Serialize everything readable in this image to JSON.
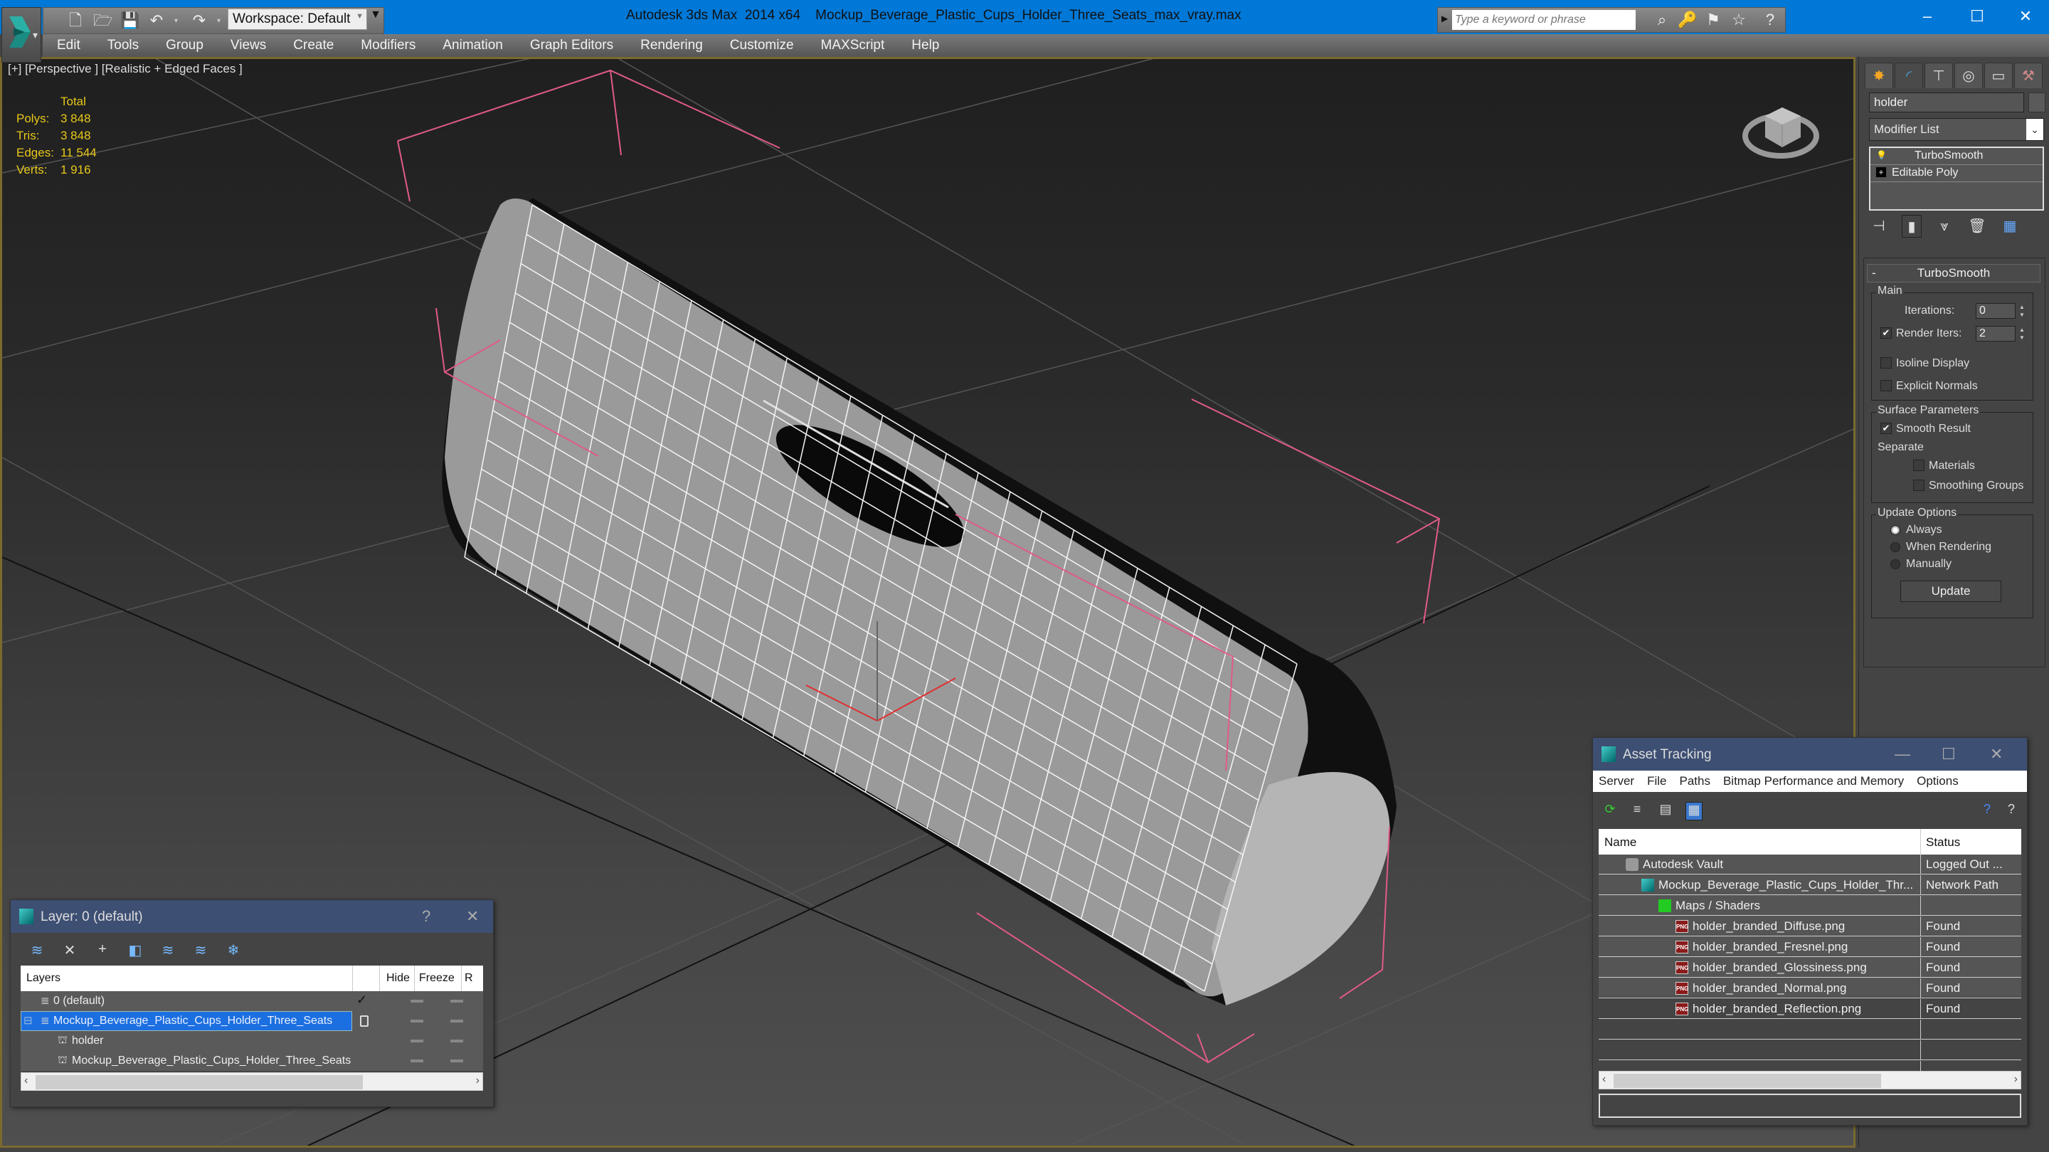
{
  "titlebar": {
    "app_title": "Autodesk 3ds Max  2014 x64",
    "file_name": "Mockup_Beverage_Plastic_Cups_Holder_Three_Seats_max_vray.max",
    "workspace_label": "Workspace: Default",
    "search_placeholder": "Type a keyword or phrase",
    "minimize": "–",
    "maximize": "☐",
    "close": "✕"
  },
  "quick_access": [
    {
      "icon": "new-file-icon",
      "glyph": "🗋"
    },
    {
      "icon": "open-file-icon",
      "glyph": "🗁"
    },
    {
      "icon": "save-icon",
      "glyph": "💾"
    },
    {
      "icon": "undo-icon",
      "glyph": "↶"
    },
    {
      "icon": "redo-icon",
      "glyph": "↷"
    },
    {
      "icon": "project-folder-icon",
      "glyph": "▤"
    }
  ],
  "search_tools": [
    {
      "icon": "binoculars-icon",
      "glyph": "⌕"
    },
    {
      "icon": "key-icon",
      "glyph": "🔑"
    },
    {
      "icon": "communication-center-icon",
      "glyph": "⚑"
    },
    {
      "icon": "favorites-star-icon",
      "glyph": "☆"
    },
    {
      "icon": "help-icon",
      "glyph": "?"
    }
  ],
  "menu": [
    "Edit",
    "Tools",
    "Group",
    "Views",
    "Create",
    "Modifiers",
    "Animation",
    "Graph Editors",
    "Rendering",
    "Customize",
    "MAXScript",
    "Help"
  ],
  "viewport": {
    "label": "[+] [Perspective ] [Realistic + Edged Faces ]",
    "stats": {
      "header": "Total",
      "rows": [
        {
          "label": "Polys:",
          "value": "3 848"
        },
        {
          "label": "Tris:",
          "value": "3 848"
        },
        {
          "label": "Edges:",
          "value": "11 544"
        },
        {
          "label": "Verts:",
          "value": "1 916"
        }
      ]
    },
    "selection_color": "#e05a8a",
    "stats_color": "#e8c81a"
  },
  "command_panel": {
    "tabs": [
      {
        "icon": "create-icon",
        "glyph": "✸"
      },
      {
        "icon": "modify-icon",
        "glyph": "◜"
      },
      {
        "icon": "hierarchy-icon",
        "glyph": "⊤"
      },
      {
        "icon": "motion-icon",
        "glyph": "◎"
      },
      {
        "icon": "display-icon",
        "glyph": "▭"
      },
      {
        "icon": "utilities-icon",
        "glyph": "⚒"
      }
    ],
    "object_name": "holder",
    "modifier_list": "Modifier List",
    "stack": [
      {
        "label": "TurboSmooth",
        "icon": "lightbulb-icon"
      },
      {
        "label": "Editable Poly",
        "icon": "expand-plus-icon"
      }
    ],
    "stack_tools": [
      {
        "icon": "pin-stack-icon",
        "glyph": "⊣"
      },
      {
        "icon": "show-end-result-icon",
        "glyph": "▮"
      },
      {
        "icon": "make-unique-icon",
        "glyph": "⩔"
      },
      {
        "icon": "remove-modifier-icon",
        "glyph": "🗑"
      },
      {
        "icon": "configure-modifier-sets-icon",
        "glyph": "▦"
      }
    ],
    "turbosmooth": {
      "title": "TurboSmooth",
      "collapse": "-",
      "main_title": "Main",
      "iterations_label": "Iterations:",
      "iterations_value": "0",
      "render_iters_label": "Render Iters:",
      "render_iters_value": "2",
      "render_iters_checked": true,
      "isoline_label": "Isoline Display",
      "isoline_checked": false,
      "explicit_normals_label": "Explicit Normals",
      "explicit_normals_checked": false,
      "surface_title": "Surface Parameters",
      "smooth_result_label": "Smooth Result",
      "smooth_result_checked": true,
      "separate_label": "Separate",
      "materials_label": "Materials",
      "materials_checked": false,
      "smoothing_groups_label": "Smoothing Groups",
      "smoothing_groups_checked": false,
      "update_title": "Update Options",
      "update_options": [
        "Always",
        "When Rendering",
        "Manually"
      ],
      "update_selected": "Always",
      "update_button": "Update"
    }
  },
  "layer_dialog": {
    "title": "Layer: 0 (default)",
    "help": "?",
    "close": "✕",
    "tools": [
      {
        "icon": "create-new-layer-icon",
        "glyph": "≋"
      },
      {
        "icon": "delete-layer-icon",
        "glyph": "✕"
      },
      {
        "icon": "add-to-layer-icon",
        "glyph": "+"
      },
      {
        "icon": "select-objects-in-layer-icon",
        "glyph": "◧"
      },
      {
        "icon": "highlight-selected-layer-icon",
        "glyph": "≋"
      },
      {
        "icon": "hide-unhide-all-icon",
        "glyph": "≋"
      },
      {
        "icon": "freeze-unfreeze-all-icon",
        "glyph": "❄"
      }
    ],
    "columns": [
      "Layers",
      "Hide",
      "Freeze",
      "R"
    ],
    "rows": [
      {
        "name": "0 (default)",
        "type": "layer",
        "current": true
      },
      {
        "name": "Mockup_Beverage_Plastic_Cups_Holder_Three_Seats",
        "type": "layer",
        "selected": true
      },
      {
        "name": "holder",
        "type": "object"
      },
      {
        "name": "Mockup_Beverage_Plastic_Cups_Holder_Three_Seats",
        "type": "object"
      }
    ]
  },
  "asset_tracking": {
    "title": "Asset Tracking",
    "minimize": "—",
    "maximize": "☐",
    "close": "✕",
    "menu": [
      "Server",
      "File",
      "Paths",
      "Bitmap Performance and Memory",
      "Options"
    ],
    "columns": [
      "Name",
      "Status"
    ],
    "rows": [
      {
        "name": "Autodesk Vault",
        "status": "Logged Out ...",
        "level": 1,
        "icon": "vault-icon"
      },
      {
        "name": "Mockup_Beverage_Plastic_Cups_Holder_Thr...",
        "status": "Network Path",
        "level": 2,
        "icon": "max-file-icon"
      },
      {
        "name": "Maps / Shaders",
        "status": "",
        "level": 3,
        "icon": "maps-icon"
      },
      {
        "name": "holder_branded_Diffuse.png",
        "status": "Found",
        "level": 4,
        "icon": "png-icon"
      },
      {
        "name": "holder_branded_Fresnel.png",
        "status": "Found",
        "level": 4,
        "icon": "png-icon"
      },
      {
        "name": "holder_branded_Glossiness.png",
        "status": "Found",
        "level": 4,
        "icon": "png-icon"
      },
      {
        "name": "holder_branded_Normal.png",
        "status": "Found",
        "level": 4,
        "icon": "png-icon"
      },
      {
        "name": "holder_branded_Reflection.png",
        "status": "Found",
        "level": 4,
        "icon": "png-icon"
      }
    ]
  }
}
